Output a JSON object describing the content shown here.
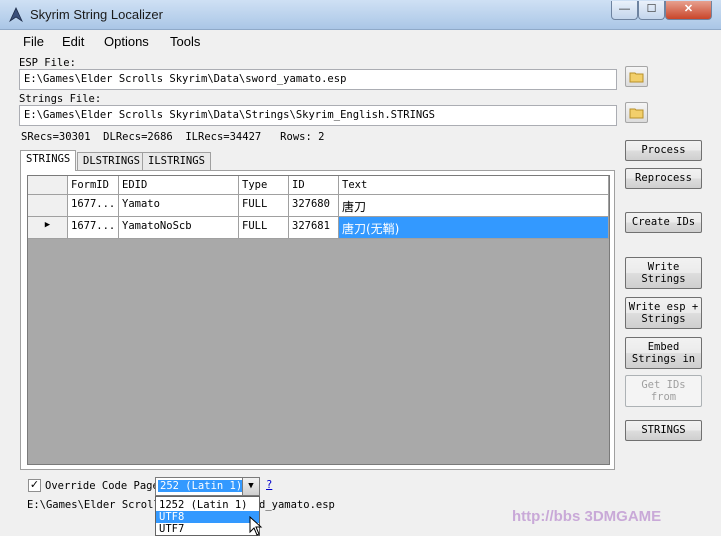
{
  "window": {
    "title": "Skyrim String Localizer",
    "minimize": "—",
    "maximize": "☐",
    "close": "✕"
  },
  "menu": {
    "file": "File",
    "edit": "Edit",
    "options": "Options",
    "tools": "Tools"
  },
  "esp_file": {
    "label": "ESP File:",
    "value": "E:\\Games\\Elder Scrolls Skyrim\\Data\\sword_yamato.esp"
  },
  "strings_file": {
    "label": "Strings File:",
    "value": "E:\\Games\\Elder Scrolls Skyrim\\Data\\Strings\\Skyrim_English.STRINGS"
  },
  "stats": "SRecs=30301  DLRecs=2686  ILRecs=34427   Rows: 2",
  "tabs": {
    "strings": "STRINGS",
    "dlstrings": "DLSTRINGS",
    "ilstrings": "ILSTRINGS"
  },
  "table": {
    "columns": {
      "formid": "FormID",
      "edid": "EDID",
      "type": "Type",
      "id": "ID",
      "text": "Text"
    },
    "rows": [
      {
        "marker": "",
        "formid": "1677...",
        "edid": "Yamato",
        "type": "FULL",
        "id": "327680",
        "text": "唐刀"
      },
      {
        "marker": "▶",
        "formid": "1677...",
        "edid": "YamatoNoScb",
        "type": "FULL",
        "id": "327681",
        "text": "唐刀(无鞘)"
      }
    ]
  },
  "buttons": {
    "process": "Process",
    "reprocess": "Reprocess",
    "create_ids": "Create IDs",
    "write_strings_1": "Write",
    "write_strings_2": "Strings",
    "write_esp_1": "Write esp +",
    "write_esp_2": "Strings",
    "embed_1": "Embed",
    "embed_2": "Strings in",
    "get_ids_1": "Get IDs",
    "get_ids_2": "from",
    "strings": "STRINGS"
  },
  "override": {
    "checked": "✓",
    "label": "Override Code Page:",
    "selected": "252 (Latin 1)",
    "arrow": "▼",
    "help": "?",
    "options": [
      "1252 (Latin 1)",
      "UTF8",
      "UTF7"
    ],
    "highlighted_option": "UTF8"
  },
  "bottom_path_left": "E:\\Games\\Elder Scrolls",
  "bottom_path_right": "d_yamato.esp",
  "watermark": "http://bbs  3DMGAME",
  "colors": {
    "selection": "#3399ff",
    "grid_bg": "#a9a9a9"
  }
}
